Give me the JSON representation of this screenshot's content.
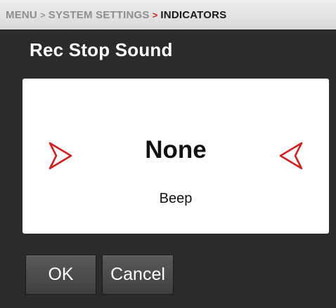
{
  "breadcrumb": {
    "items": [
      "MENU",
      "SYSTEM SETTINGS",
      "INDICATORS"
    ],
    "separator": ">"
  },
  "title": "Rec Stop Sound",
  "picker": {
    "selected": "None",
    "next_option": "Beep",
    "left_arrow_icon": "chevron-right-outline-icon",
    "right_arrow_icon": "chevron-left-outline-icon",
    "arrow_color": "#d31f1f"
  },
  "buttons": {
    "ok_label": "OK",
    "cancel_label": "Cancel"
  }
}
